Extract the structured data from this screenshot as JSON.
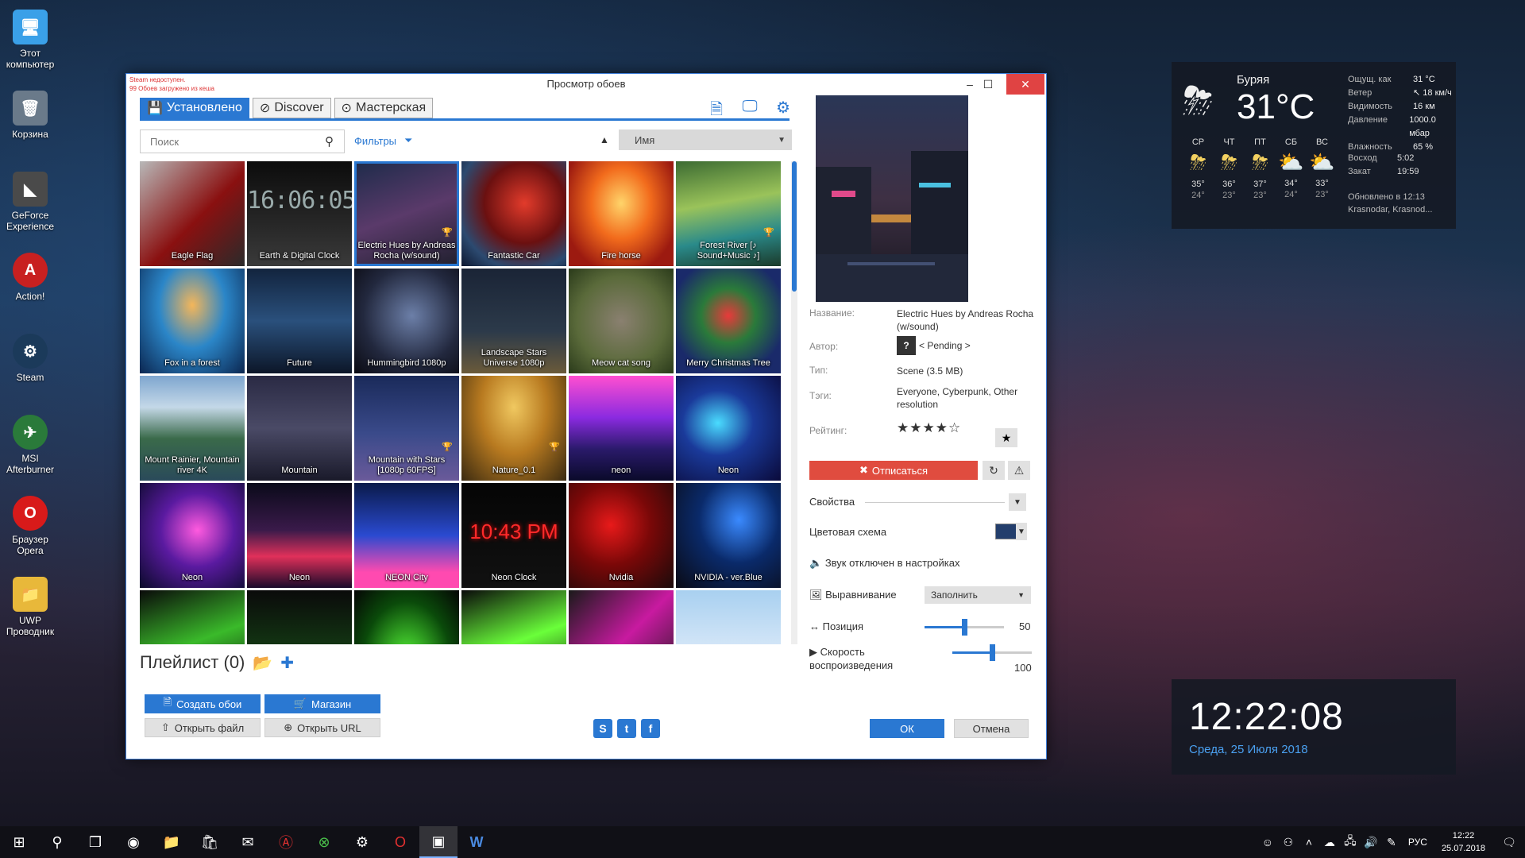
{
  "desktop": {
    "icons": [
      {
        "label": "Этот компьютер"
      },
      {
        "label": "Корзина"
      },
      {
        "label": "GeForce Experience"
      },
      {
        "label": "Action!"
      },
      {
        "label": "Steam"
      },
      {
        "label": "MSI Afterburner"
      },
      {
        "label": "Браузер Opera"
      },
      {
        "label": "UWP Проводник"
      }
    ]
  },
  "weather": {
    "city": "Буряя",
    "temp": "31°C",
    "details": [
      {
        "k": "Ощущ. как",
        "v": "31 °C"
      },
      {
        "k": "Ветер",
        "v": "↖ 18 км/ч"
      },
      {
        "k": "Видимость",
        "v": "16 км"
      },
      {
        "k": "Давление",
        "v": "1000.0 мбар"
      },
      {
        "k": "Влажность",
        "v": "65 %"
      }
    ],
    "days": [
      {
        "d": "СР",
        "hi": "35°",
        "lo": "24°"
      },
      {
        "d": "ЧТ",
        "hi": "36°",
        "lo": "23°"
      },
      {
        "d": "ПТ",
        "hi": "37°",
        "lo": "23°"
      },
      {
        "d": "СБ",
        "hi": "34°",
        "lo": "24°"
      },
      {
        "d": "ВС",
        "hi": "33°",
        "lo": "23°"
      }
    ],
    "sunrise_k": "Восход",
    "sunrise_v": "5:02",
    "sunset_k": "Закат",
    "sunset_v": "19:59",
    "updated": "Обновлено в 12:13",
    "location": "Krasnodar, Krasnod..."
  },
  "clock": {
    "time": "12:22:08",
    "date": "Среда, 25 Июля 2018"
  },
  "window": {
    "title": "Просмотр обоев",
    "status_1": "Steam недоступен.",
    "status_2": "99 Обоев загружено из кеша",
    "tabs": [
      "Установлено",
      "Discover",
      "Мастерская"
    ],
    "search_placeholder": "Поиск",
    "filters_label": "Фильтры",
    "sort_value": "Имя",
    "wallpapers": [
      {
        "name": "Eagle Flag",
        "bg": "linear-gradient(135deg,#b8b8b8,#8a1010 55%,#2a2a2a)"
      },
      {
        "name": "Earth & Digital Clock",
        "bg": "linear-gradient(180deg,#0c0c0c,#272727 60%,#3a3a3a)"
      },
      {
        "name": "Electric Hues by Andreas Rocha (w/sound)",
        "bg": "linear-gradient(160deg,#1d2b4a,#5a3a6a 50%,#20202e)"
      },
      {
        "name": "Fantastic Car",
        "bg": "radial-gradient(ellipse at 60% 40%,#e23b2b,#6b1010 45%,#2c4a70 75%,#0e1830)"
      },
      {
        "name": "Fire horse",
        "bg": "radial-gradient(ellipse at 50% 40%,#ffd46a,#f26b1c 40%,#9c1a10 80%)"
      },
      {
        "name": "Forest River [♪ Sound+Music ♪]",
        "bg": "linear-gradient(170deg,#3c6b32,#9ac35a 40%,#2a8a8a 70%,#1b3a2a)"
      },
      {
        "name": "Fox in a forest",
        "bg": "radial-gradient(ellipse at 50% 35%,#f4b65a,#2b86c8 45%,#0b2650)"
      },
      {
        "name": "Future",
        "bg": "linear-gradient(180deg,#12243e,#2a507c 50%,#0c1628)"
      },
      {
        "name": "Hummingbird 1080p",
        "bg": "radial-gradient(circle at 55% 45%,#6c7fa8,#22283e 60%,#0a0a12)"
      },
      {
        "name": "Landscape Stars Universe 1080p",
        "bg": "linear-gradient(180deg,#1a2436,#2c3a4a 60%,#6a5a3a)"
      },
      {
        "name": "Meow cat song",
        "bg": "radial-gradient(ellipse at 50% 50%,#8a8070,#5a6a3a 60%,#2a3a1a)"
      },
      {
        "name": "Merry Christmas Tree",
        "bg": "radial-gradient(circle at 50% 45%,#e83a3a,#2a7a3a 35%,#1a2a6a 75%)"
      },
      {
        "name": "Mount Rainier, Mountain river 4K",
        "bg": "linear-gradient(180deg,#7ea6cf,#c4d8e8 30%,#3a6a4a 60%,#2a4a5a)"
      },
      {
        "name": "Mountain",
        "bg": "linear-gradient(180deg,#2a2a44,#4a4a66 50%,#1a1a2a)"
      },
      {
        "name": "Mountain with Stars [1080p 60FPS]",
        "bg": "linear-gradient(180deg,#1a2a5a,#3a4a8a 55%,#6a5a9a)"
      },
      {
        "name": "Nature_0.1",
        "bg": "radial-gradient(ellipse at 50% 30%,#f0c860,#b87a20 45%,#3a2a10)"
      },
      {
        "name": "neon",
        "bg": "linear-gradient(180deg,#ff4fd0,#8a2ae0 40%,#2a1a6a 70%,#0a0a2a)"
      },
      {
        "name": "Neon",
        "bg": "radial-gradient(ellipse at 40% 45%,#4adcff,#1a3a9a 40%,#0a0a3a)"
      },
      {
        "name": "Neon",
        "bg": "radial-gradient(ellipse at 55% 45%,#ff5adf,#5a1aa0 45%,#0a0a2a)"
      },
      {
        "name": "Neon",
        "bg": "linear-gradient(180deg,#0a0a1a,#3a1a4a 45%,#e0305a 70%,#1a0a2a)"
      },
      {
        "name": "NEON City",
        "bg": "linear-gradient(180deg,#0a1a4a,#2a4ad0 50%,#ff4ab0 85%)"
      },
      {
        "name": "Neon Clock",
        "bg": "linear-gradient(180deg,#050505,#111 100%)"
      },
      {
        "name": "Nvidia",
        "bg": "radial-gradient(ellipse at 40% 40%,#e81a1a,#7a0808 45%,#1a0a0a)"
      },
      {
        "name": "NVIDIA - ver.Blue",
        "bg": "radial-gradient(ellipse at 60% 35%,#3a8aff,#0a2a6a 45%,#0a0a14)"
      },
      {
        "name": "",
        "bg": "linear-gradient(160deg,#0a0a0a,#3aba2a 50%,#0a0a0a)"
      },
      {
        "name": "",
        "bg": "linear-gradient(180deg,#0a0a0a,#1a5a1a 100%)"
      },
      {
        "name": "",
        "bg": "radial-gradient(ellipse at 50% 70%,#5aff3a,#0a4a0a 60%,#050505)"
      },
      {
        "name": "",
        "bg": "linear-gradient(160deg,#0a0a0a,#6aff3a 50%,#0a0a0a)"
      },
      {
        "name": "",
        "bg": "linear-gradient(135deg,#1a1a1a,#c81aa0 50%,#1a1a1a)"
      },
      {
        "name": "",
        "bg": "linear-gradient(180deg,#a8d0f0,#d8e8f8 60%,#7aa8d8)"
      }
    ],
    "neon_clock_text": "10:43 PM",
    "earth_clock_text": "16:06:05",
    "playlist_label": "Плейлист (0)",
    "btn_create": "Создать обои",
    "btn_shop": "Магазин",
    "btn_open_file": "Открыть файл",
    "btn_open_url": "Открыть URL",
    "btn_ok": "ОК",
    "btn_cancel": "Отмена",
    "details": {
      "name_k": "Название:",
      "name_v": "Electric Hues by Andreas Rocha (w/sound)",
      "author_k": "Автор:",
      "author_v": "< Pending >",
      "type_k": "Тип:",
      "type_v": "Scene (3.5 MB)",
      "tags_k": "Тэги:",
      "tags_v": "Everyone, Cyberpunk, Other resolution",
      "rating_k": "Рейтинг:",
      "rating_stars": "★★★★☆",
      "rating_value": 4
    },
    "unsubscribe": "Отписаться",
    "props_label": "Свойства",
    "color_scheme_label": "Цветовая схема",
    "color_scheme_color": "#233e6c",
    "sound_label": "Звук отключен в настройках",
    "alignment_label": "Выравнивание",
    "alignment_value": "Заполнить",
    "position_label": "Позиция",
    "position_value": "50",
    "speed_label_1": "Скорость",
    "speed_label_2": "воспроизведения",
    "speed_value": "100"
  },
  "taskbar": {
    "lang": "РУС",
    "time": "12:22",
    "date": "25.07.2018"
  }
}
